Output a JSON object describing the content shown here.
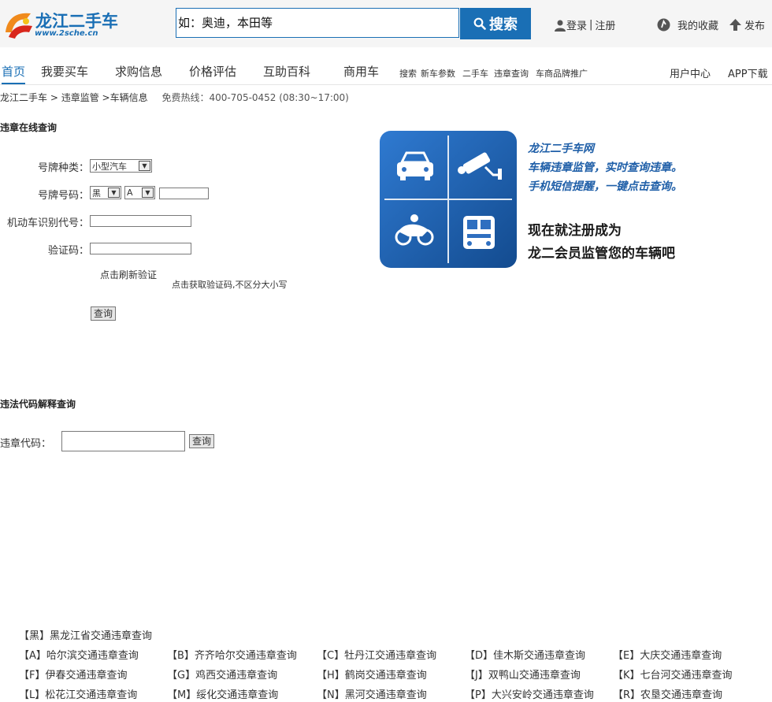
{
  "header": {
    "logo_text": "龙江二手车",
    "logo_url": "www.2sche.cn",
    "search_placeholder": "如：奥迪，本田等",
    "search_button": "搜索",
    "login": "登录",
    "separator": "|",
    "register": "注册",
    "favorites": "我的收藏",
    "sell": "发布"
  },
  "nav": {
    "items": [
      "首页",
      "我要买车",
      "求购信息",
      "价格评估",
      "互助百科",
      "商用车"
    ],
    "sub_items": [
      "搜索",
      "新车参数",
      "二手车",
      "违章查询",
      "车商品牌推广"
    ],
    "user_center": "用户中心",
    "app_download": "APP下载"
  },
  "breadcrumb": {
    "home": "龙江二手车",
    "sep1": " > ",
    "level2": "违章监管",
    "sep2": " >",
    "level3": "车辆信息",
    "hotline": "免费热线：400-705-0452 (08:30~17:00)"
  },
  "query_form": {
    "title": "违章在线查询",
    "plate_type_label": "号牌种类：",
    "plate_type_value": "小型汽车",
    "plate_number_label": "号牌号码：",
    "province_value": "黑",
    "letter_value": "A",
    "vin_label": "机动车识别代号：",
    "captcha_label": "验证码：",
    "refresh_captcha": "点击刷新验证",
    "captcha_hint": "点击获取验证码,不区分大小写",
    "submit": "查询"
  },
  "banner": {
    "brand": "龙江二手车网",
    "line1": "车辆违章监管，实时查询违章。",
    "line2": "手机短信提醒，一键点击查询。",
    "cta1": "现在就注册成为",
    "cta2": "龙二会员监管您的车辆吧"
  },
  "code_query": {
    "title": "违法代码解释查询",
    "label": "违章代码：",
    "submit": "查询"
  },
  "regions": {
    "heilongjiang": "【黑】黑龙江省交通违章查询",
    "rows": [
      [
        "【A】哈尔滨交通违章查询",
        "【B】齐齐哈尔交通违章查询",
        "【C】牡丹江交通违章查询",
        "【D】佳木斯交通违章查询",
        "【E】大庆交通违章查询"
      ],
      [
        "【F】伊春交通违章查询",
        "【G】鸡西交通违章查询",
        "【H】鹤岗交通违章查询",
        "【J】双鸭山交通违章查询",
        "【K】七台河交通违章查询"
      ],
      [
        "【L】松花江交通违章查询",
        "【M】绥化交通违章查询",
        "【N】黑河交通违章查询",
        "【P】大兴安岭交通违章查询",
        "【R】农垦交通违章查询"
      ]
    ]
  },
  "colors": {
    "brand_blue": "#1a6fb5",
    "banner_blue": "#1f5fa8"
  }
}
